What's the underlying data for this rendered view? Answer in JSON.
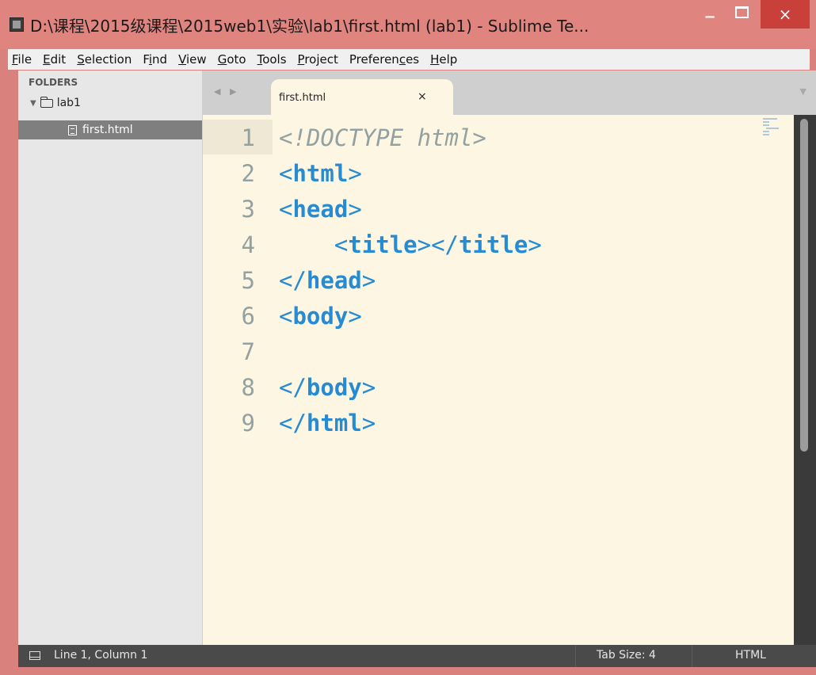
{
  "window": {
    "title": "D:\\课程\\2015级课程\\2015web1\\实验\\lab1\\first.html (lab1) - Sublime Te...",
    "minimize": "−",
    "close": "×"
  },
  "menu": [
    "File",
    "Edit",
    "Selection",
    "Find",
    "View",
    "Goto",
    "Tools",
    "Project",
    "Preferences",
    "Help"
  ],
  "sidebar": {
    "header": "FOLDERS",
    "folder": "lab1",
    "file": "first.html"
  },
  "tabs": [
    {
      "title": "first.html",
      "close": "×"
    }
  ],
  "editor": {
    "lines": [
      {
        "n": "1",
        "text": "<!DOCTYPE html>"
      },
      {
        "n": "2",
        "text": "<html>"
      },
      {
        "n": "3",
        "text": "<head>"
      },
      {
        "n": "4",
        "text": "    <title></title>"
      },
      {
        "n": "5",
        "text": "</head>"
      },
      {
        "n": "6",
        "text": "<body>"
      },
      {
        "n": "7",
        "text": ""
      },
      {
        "n": "8",
        "text": "</body>"
      },
      {
        "n": "9",
        "text": "</html>"
      }
    ]
  },
  "status": {
    "position": "Line 1, Column 1",
    "tab_size": "Tab Size: 4",
    "syntax": "HTML"
  },
  "colors": {
    "frame": "#e0847f",
    "editor_bg": "#fdf6e3",
    "tag": "#268bd2",
    "comment": "#93a1a1",
    "close_button": "#c9403a"
  }
}
